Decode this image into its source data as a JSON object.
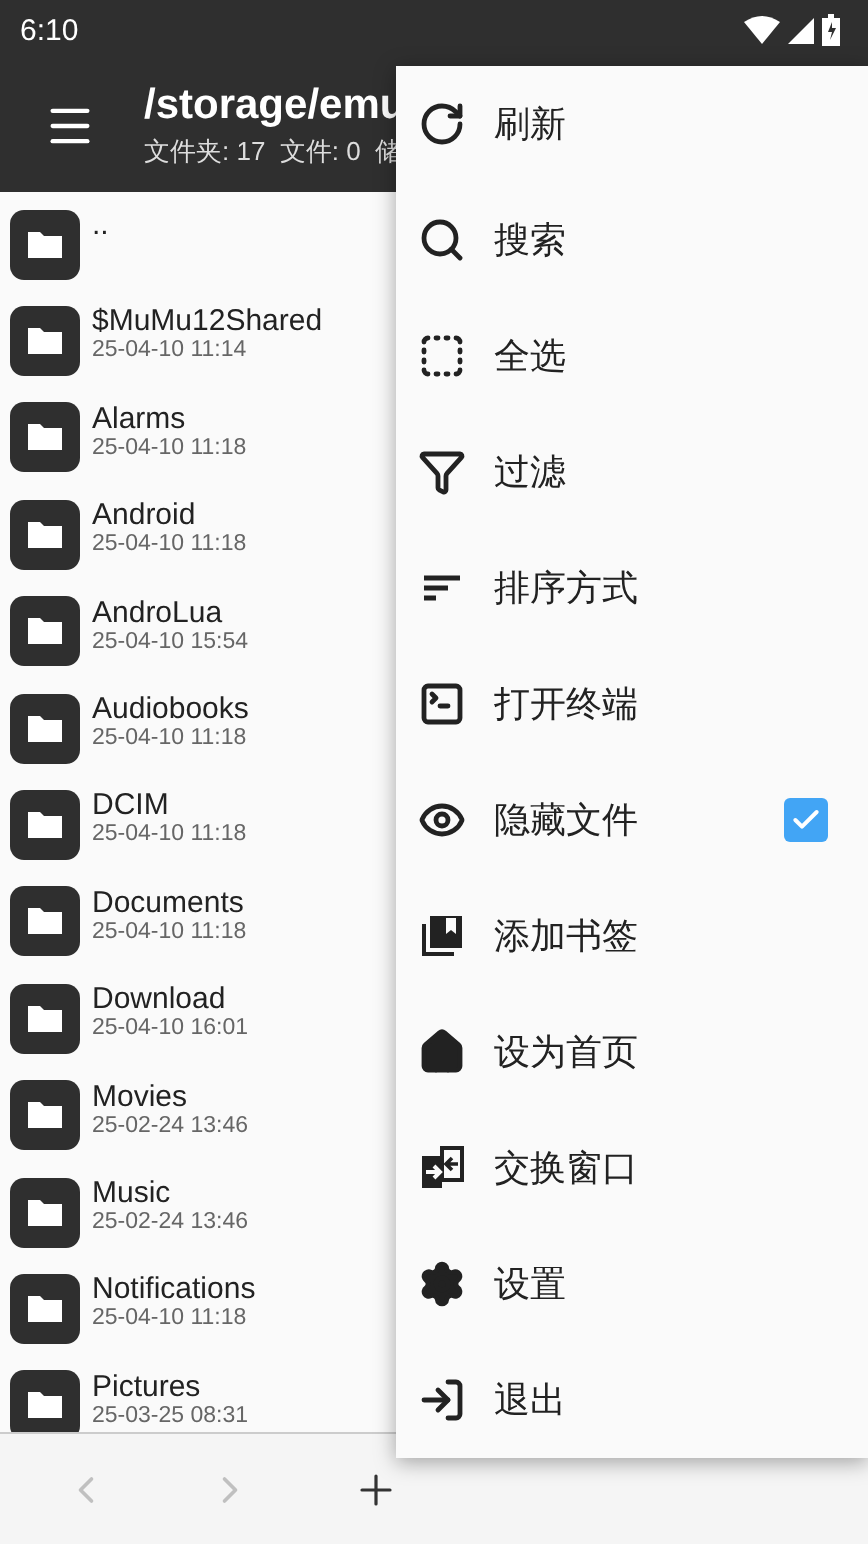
{
  "status_bar": {
    "time": "6:10"
  },
  "toolbar": {
    "title": "/storage/emu",
    "subtitle": "文件夹: 17  文件: 0  储"
  },
  "files": [
    {
      "name": ".."
    },
    {
      "name": "$MuMu12Shared",
      "date": "25-04-10 11:14"
    },
    {
      "name": "Alarms",
      "date": "25-04-10 11:18"
    },
    {
      "name": "Android",
      "date": "25-04-10 11:18"
    },
    {
      "name": "AndroLua",
      "date": "25-04-10 15:54"
    },
    {
      "name": "Audiobooks",
      "date": "25-04-10 11:18"
    },
    {
      "name": "DCIM",
      "date": "25-04-10 11:18"
    },
    {
      "name": "Documents",
      "date": "25-04-10 11:18"
    },
    {
      "name": "Download",
      "date": "25-04-10 16:01"
    },
    {
      "name": "Movies",
      "date": "25-02-24 13:46"
    },
    {
      "name": "Music",
      "date": "25-02-24 13:46"
    },
    {
      "name": "Notifications",
      "date": "25-04-10 11:18"
    },
    {
      "name": "Pictures",
      "date": "25-03-25 08:31"
    }
  ],
  "bottom_bar": {
    "back_disabled": true,
    "forward_disabled": true
  },
  "menu": [
    {
      "kind": "action",
      "label": "刷新"
    },
    {
      "kind": "action",
      "label": "搜索"
    },
    {
      "kind": "action",
      "label": "全选"
    },
    {
      "kind": "action",
      "label": "过滤"
    },
    {
      "kind": "action",
      "label": "排序方式"
    },
    {
      "kind": "action",
      "label": "打开终端"
    },
    {
      "kind": "checkbox",
      "label": "隐藏文件",
      "checked": true
    },
    {
      "kind": "action",
      "label": "添加书签"
    },
    {
      "kind": "action",
      "label": "设为首页"
    },
    {
      "kind": "action",
      "label": "交换窗口"
    },
    {
      "kind": "action",
      "label": "设置"
    },
    {
      "kind": "action",
      "label": "退出"
    }
  ]
}
